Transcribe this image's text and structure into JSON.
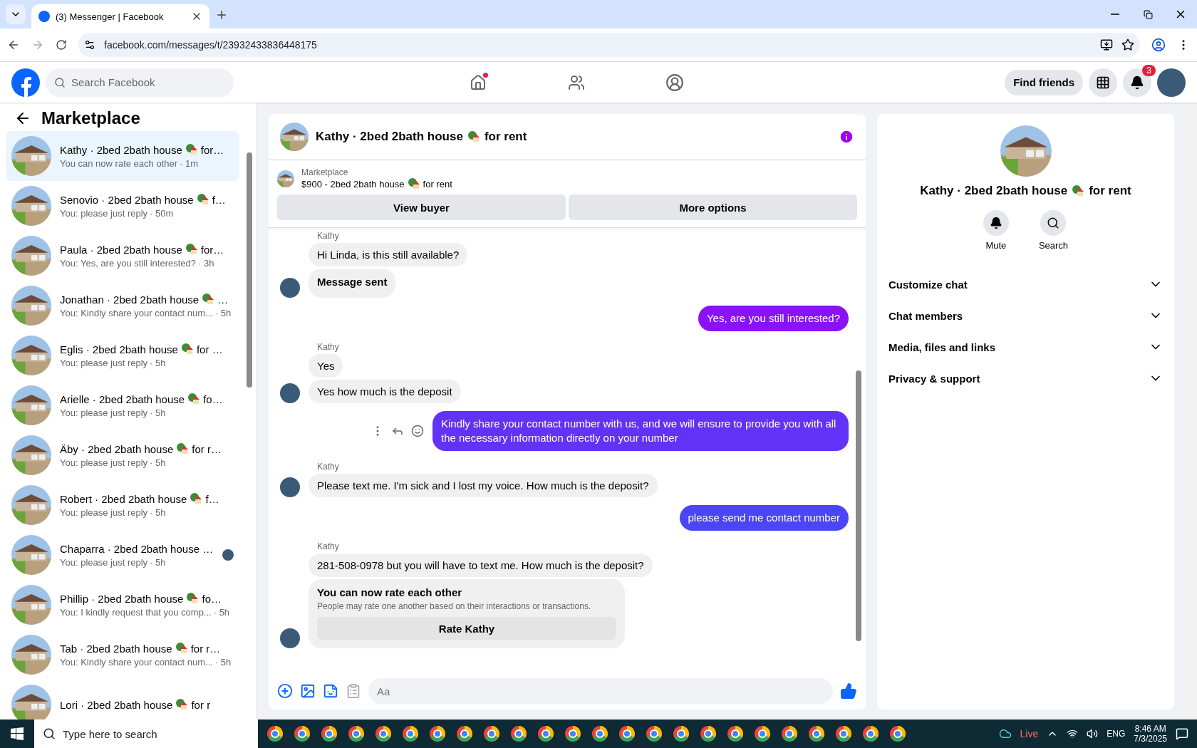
{
  "browser": {
    "tab_title": "(3) Messenger | Facebook",
    "url": "facebook.com/messages/t/23932433836448175"
  },
  "header": {
    "search_placeholder": "Search Facebook",
    "find_friends": "Find friends",
    "notification_count": "3",
    "home_unread": true
  },
  "sidebar": {
    "title": "Marketplace",
    "conversations": [
      {
        "title": "Kathy · 2bed 2bath house",
        "emoji": true,
        "title_end": "for…",
        "preview": "You can now rate each other",
        "time": "· 1m",
        "selected": true,
        "seen_avatar": false
      },
      {
        "title": "Senovio · 2bed 2bath house",
        "emoji": true,
        "title_end": "f…",
        "preview": "You: please just reply",
        "time": "· 50m",
        "selected": false,
        "seen_avatar": false
      },
      {
        "title": "Paula · 2bed 2bath house",
        "emoji": true,
        "title_end": "for…",
        "preview": "You: Yes, are you still interested?",
        "time": "· 3h",
        "selected": false,
        "seen_avatar": false
      },
      {
        "title": "Jonathan · 2bed 2bath house",
        "emoji": true,
        "title_end": "…",
        "preview": "You: Kindly share your contact num...",
        "time": "· 5h",
        "selected": false,
        "seen_avatar": false
      },
      {
        "title": "Eglis · 2bed 2bath house",
        "emoji": true,
        "title_end": "for …",
        "preview": "You: please just reply",
        "time": "· 5h",
        "selected": false,
        "seen_avatar": false
      },
      {
        "title": "Arielle · 2bed 2bath house",
        "emoji": true,
        "title_end": "fo…",
        "preview": "You: please just reply",
        "time": "· 5h",
        "selected": false,
        "seen_avatar": false
      },
      {
        "title": "Äby · 2bed 2bath house",
        "emoji": true,
        "title_end": "for r…",
        "preview": "You: please just reply",
        "time": "· 5h",
        "selected": false,
        "seen_avatar": false
      },
      {
        "title": "Robert · 2bed 2bath house",
        "emoji": true,
        "title_end": "f…",
        "preview": "You: please just reply",
        "time": "· 5h",
        "selected": false,
        "seen_avatar": false
      },
      {
        "title": "Chaparra · 2bed 2bath house …",
        "emoji": false,
        "preview": "You: please just reply",
        "time": "· 5h",
        "selected": false,
        "seen_avatar": true
      },
      {
        "title": "Phillip · 2bed 2bath house",
        "emoji": true,
        "title_end": "fo…",
        "preview": "You: I kindly request that you comp...",
        "time": "· 5h",
        "selected": false,
        "seen_avatar": false
      },
      {
        "title": "Tab · 2bed 2bath house",
        "emoji": true,
        "title_end": "for r…",
        "preview": "You: Kindly share your contact num...",
        "time": "· 5h",
        "selected": false,
        "seen_avatar": false
      },
      {
        "title": "Lori · 2bed 2bath house",
        "emoji": true,
        "title_end": "for r",
        "selected": false,
        "seen_avatar": false
      }
    ]
  },
  "chat": {
    "title": "Kathy · 2bed 2bath house",
    "title_end": "for rent",
    "listing": {
      "label": "Marketplace",
      "price_title": "$900 - 2bed 2bath house",
      "price_title_end": "for rent",
      "buttons": [
        "View buyer",
        "More options"
      ]
    },
    "messages": [
      {
        "kind": "sender",
        "text": "Kathy"
      },
      {
        "kind": "incoming",
        "text": "Hi Linda, is this still available?",
        "avatar": false,
        "bold": false
      },
      {
        "kind": "incoming",
        "text": "Message sent",
        "avatar": true,
        "bold": true
      },
      {
        "kind": "outgoing",
        "text": "Yes, are you still interested?",
        "color": "#8a12f7",
        "actions": false
      },
      {
        "kind": "sender",
        "text": "Kathy"
      },
      {
        "kind": "incoming",
        "text": "Yes",
        "avatar": false,
        "bold": false
      },
      {
        "kind": "incoming",
        "text": "Yes how much is the deposit",
        "avatar": true,
        "bold": false
      },
      {
        "kind": "outgoing",
        "text": "Kindly share your contact number with us, and we will ensure to provide you with all the necessary information directly on your number",
        "color": "#6233f6",
        "actions": true
      },
      {
        "kind": "sender",
        "text": "Kathy"
      },
      {
        "kind": "incoming",
        "text": "Please text me. I'm sick and I lost my voice. How much is the deposit?",
        "avatar": true,
        "bold": false
      },
      {
        "kind": "outgoing",
        "text": "please send me contact number",
        "color": "#4a45f6",
        "actions": false
      },
      {
        "kind": "sender",
        "text": "Kathy"
      },
      {
        "kind": "incoming",
        "text": "281-508-0978 but you will have to text me. How much is the deposit?",
        "avatar": false,
        "bold": false
      },
      {
        "kind": "rating",
        "title": "You can now rate each other",
        "text": "People may rate one another based on their interactions or transactions.",
        "button": "Rate Kathy"
      }
    ],
    "composer_placeholder": "Aa"
  },
  "details": {
    "title": "Kathy · 2bed 2bath house",
    "title_end": "for rent",
    "actions": [
      {
        "kind": "mute",
        "label": "Mute"
      },
      {
        "kind": "search",
        "label": "Search"
      }
    ],
    "sections": [
      {
        "label": "Customize chat",
        "expanded": false
      },
      {
        "label": "Chat members",
        "expanded": false
      },
      {
        "label": "Media, files and links",
        "expanded": false
      },
      {
        "label": "Privacy & support",
        "expanded": false
      }
    ]
  },
  "taskbar": {
    "search_placeholder": "Type here to search",
    "weather": "Live",
    "language": "ENG",
    "time": "8:46 AM",
    "date": "7/3/2025"
  }
}
